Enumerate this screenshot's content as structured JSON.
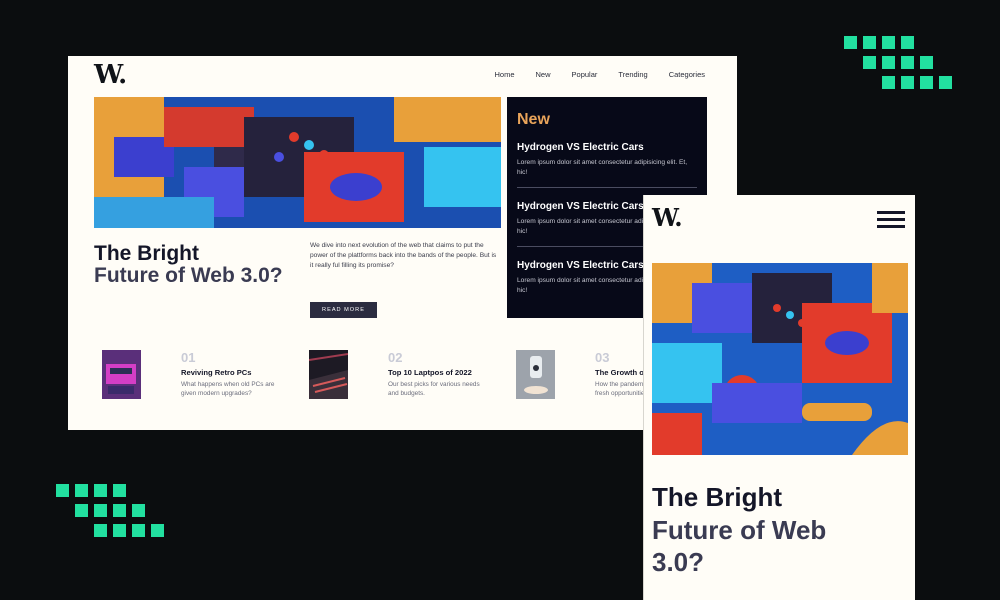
{
  "brand": {
    "logo": "W."
  },
  "nav": {
    "items": [
      "Home",
      "New",
      "Popular",
      "Trending",
      "Categories"
    ]
  },
  "hero": {
    "headline_line1": "The Bright",
    "headline_rest": "Future of Web 3.0?",
    "description": "We dive into next evolution of the web that claims to put the power of the plattforms back into the bands of the people. But is it really ful filling its promise?",
    "button_label": "READ MORE"
  },
  "new_panel": {
    "title": "New",
    "items": [
      {
        "title": "Hydrogen VS Electric Cars",
        "text": "Lorem ipsum dolor sit amet consectetur adipisicing elit. Et, hic!"
      },
      {
        "title": "Hydrogen VS Electric Cars",
        "text": "Lorem ipsum dolor sit amet consectetur adipisicing elit. Et, hic!"
      },
      {
        "title": "Hydrogen VS Electric Cars",
        "text": "Lorem ipsum dolor sit amet consectetur adipisicing elit. Et, hic!"
      }
    ]
  },
  "cards": [
    {
      "number": "01",
      "title": "Reviving Retro PCs",
      "text": "What happens when old PCs are given modern upgrades?"
    },
    {
      "number": "02",
      "title": "Top 10 Laptpos of 2022",
      "text": "Our best picks for various needs and budgets."
    },
    {
      "number": "03",
      "title": "The Growth of Gaming",
      "text": "How the pandemic has sparked fresh opportunities."
    }
  ],
  "mobile": {
    "logo": "W.",
    "headline_line1": "The Bright",
    "headline_line2": "Future of Web",
    "headline_line3": "3.0?"
  },
  "colors": {
    "accent": "#e9a45a",
    "dark": "#070918",
    "green": "#22e0a0",
    "background": "#0b0d0f"
  }
}
